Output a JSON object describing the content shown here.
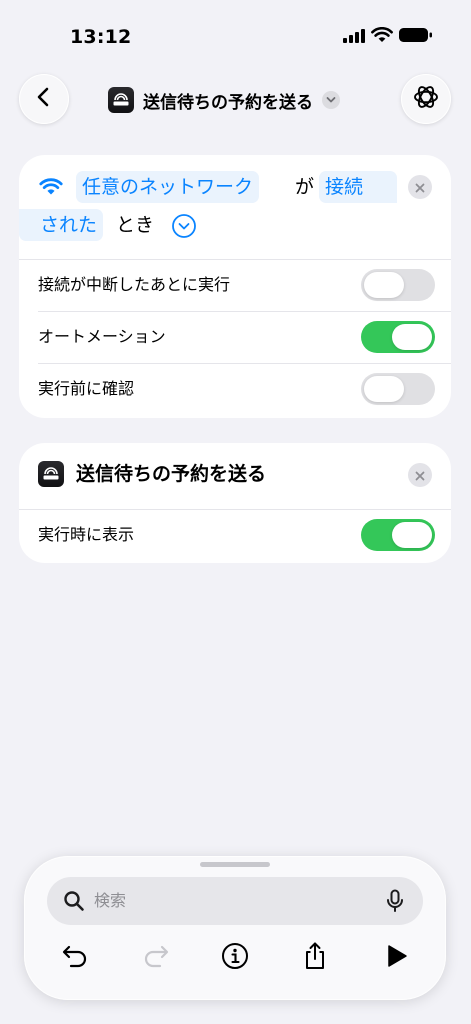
{
  "status_bar": {
    "time": "13:12"
  },
  "nav": {
    "title": "送信待ちの予約を送る",
    "icons": [
      "chevron-left-icon",
      "app-icon",
      "chevron-down-icon",
      "ai-settings-icon"
    ]
  },
  "trigger": {
    "wifi_icon": "wifi-icon",
    "network_token": "任意のネットワーク",
    "particle": "が",
    "state_token_line1": "接続",
    "state_token_line2": "された",
    "suffix": "とき",
    "rows": [
      {
        "label": "接続が中断したあとに実行",
        "on": false
      },
      {
        "label": "オートメーション",
        "on": true
      },
      {
        "label": "実行前に確認",
        "on": false
      }
    ]
  },
  "action": {
    "title": "送信待ちの予約を送る",
    "rows": [
      {
        "label": "実行時に表示",
        "on": true
      }
    ]
  },
  "toolbar": {
    "search_placeholder": "検索",
    "icons": [
      "search-icon",
      "microphone-icon",
      "undo-icon",
      "redo-icon",
      "info-icon",
      "share-icon",
      "play-icon"
    ]
  },
  "colors": {
    "accent": "#0a84ff",
    "toggle_on": "#34c759",
    "toggle_off": "#e0e0e3",
    "background": "#f2f2f7"
  }
}
